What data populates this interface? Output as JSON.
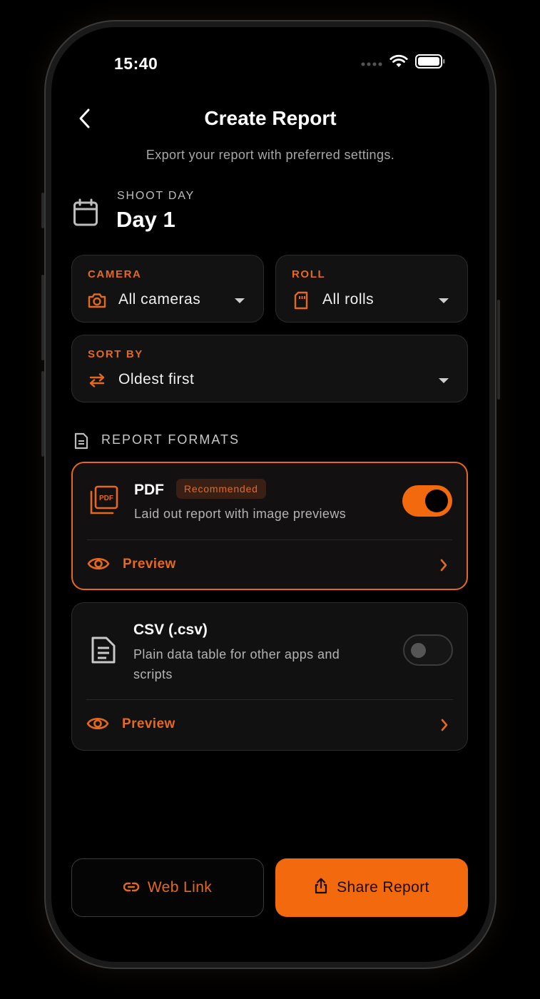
{
  "status_bar": {
    "time": "15:40"
  },
  "header": {
    "title": "Create Report",
    "subtitle": "Export your report with preferred settings."
  },
  "shoot_day": {
    "label": "SHOOT DAY",
    "value": "Day 1"
  },
  "filters": {
    "camera": {
      "label": "CAMERA",
      "value": "All cameras",
      "icon": "camera-icon"
    },
    "roll": {
      "label": "ROLL",
      "value": "All rolls",
      "icon": "sd-card-icon"
    },
    "sort": {
      "label": "SORT BY",
      "value": "Oldest first",
      "icon": "swap-arrows-icon"
    }
  },
  "formats": {
    "heading": "REPORT FORMATS",
    "items": [
      {
        "name": "PDF",
        "badge": "Recommended",
        "description": "Laid out report with image previews",
        "enabled": true,
        "preview_label": "Preview",
        "icon": "pdf-icon"
      },
      {
        "name": "CSV (.csv)",
        "description_line1": "Plain data table for other apps and",
        "description_line2": "scripts",
        "enabled": false,
        "preview_label": "Preview",
        "icon": "document-lines-icon"
      }
    ]
  },
  "actions": {
    "web_link": "Web Link",
    "share": "Share Report"
  },
  "colors": {
    "accent": "#f26a0d",
    "accent_text": "#e4691f",
    "background": "#000000",
    "card": "#121212"
  }
}
